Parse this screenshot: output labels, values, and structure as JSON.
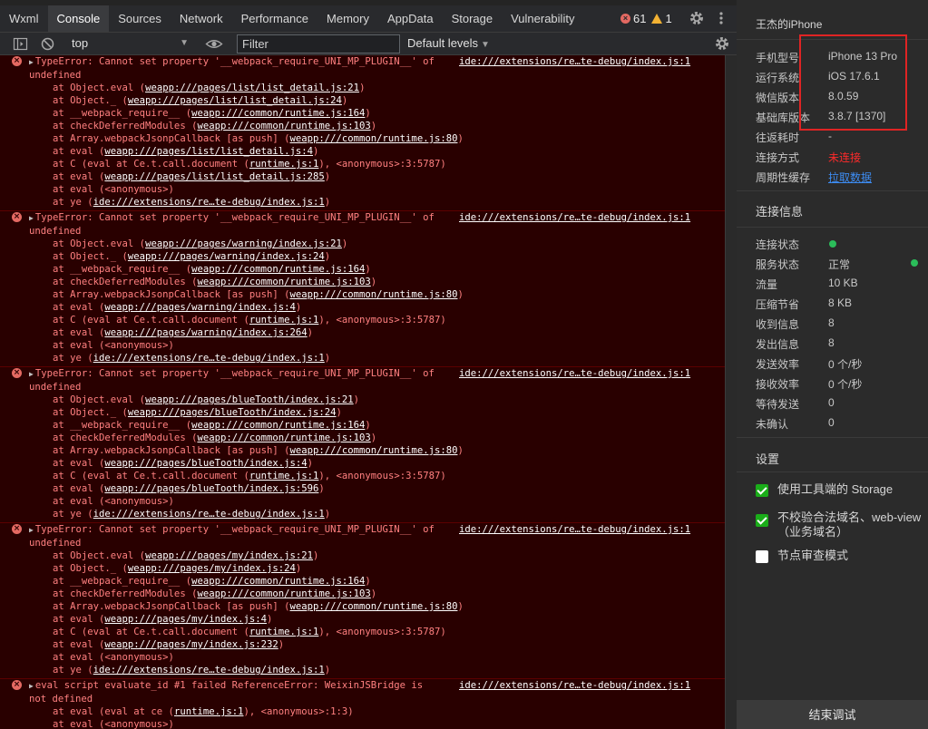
{
  "tabs": [
    "Wxml",
    "Console",
    "Sources",
    "Network",
    "Performance",
    "Memory",
    "AppData",
    "Storage",
    "Vulnerability"
  ],
  "active_tab": "Console",
  "counters": {
    "errors": "61",
    "warnings": "1"
  },
  "filterbar": {
    "context": "top",
    "filter_placeholder": "Filter",
    "levels": "Default levels"
  },
  "console": {
    "entries": [
      {
        "message": "TypeError: Cannot set property '__webpack_require_UNI_MP_PLUGIN__' of",
        "source": "ide:///extensions/re…te-debug/index.js:1",
        "continuation": "undefined",
        "frames": [
          {
            "pre": "at Object.eval (",
            "link": "weapp:///pages/list/list_detail.js:21",
            "post": ")"
          },
          {
            "pre": "at Object._ (",
            "link": "weapp:///pages/list/list_detail.js:24",
            "post": ")"
          },
          {
            "pre": "at __webpack_require__ (",
            "link": "weapp:///common/runtime.js:164",
            "post": ")"
          },
          {
            "pre": "at checkDeferredModules (",
            "link": "weapp:///common/runtime.js:103",
            "post": ")"
          },
          {
            "pre": "at Array.webpackJsonpCallback [as push] (",
            "link": "weapp:///common/runtime.js:80",
            "post": ")"
          },
          {
            "pre": "at eval (",
            "link": "weapp:///pages/list/list_detail.js:4",
            "post": ")"
          },
          {
            "pre": "at C (eval at Ce.t.call.document (",
            "link": "runtime.js:1",
            "post": "), <anonymous>:3:5787)"
          },
          {
            "pre": "at eval (",
            "link": "weapp:///pages/list/list_detail.js:285",
            "post": ")"
          },
          {
            "pre": "at eval (<anonymous>)",
            "link": "",
            "post": ""
          },
          {
            "pre": "at ye (",
            "link": "ide:///extensions/re…te-debug/index.js:1",
            "post": ")"
          }
        ]
      },
      {
        "message": "TypeError: Cannot set property '__webpack_require_UNI_MP_PLUGIN__' of",
        "source": "ide:///extensions/re…te-debug/index.js:1",
        "continuation": "undefined",
        "frames": [
          {
            "pre": "at Object.eval (",
            "link": "weapp:///pages/warning/index.js:21",
            "post": ")"
          },
          {
            "pre": "at Object._ (",
            "link": "weapp:///pages/warning/index.js:24",
            "post": ")"
          },
          {
            "pre": "at __webpack_require__ (",
            "link": "weapp:///common/runtime.js:164",
            "post": ")"
          },
          {
            "pre": "at checkDeferredModules (",
            "link": "weapp:///common/runtime.js:103",
            "post": ")"
          },
          {
            "pre": "at Array.webpackJsonpCallback [as push] (",
            "link": "weapp:///common/runtime.js:80",
            "post": ")"
          },
          {
            "pre": "at eval (",
            "link": "weapp:///pages/warning/index.js:4",
            "post": ")"
          },
          {
            "pre": "at C (eval at Ce.t.call.document (",
            "link": "runtime.js:1",
            "post": "), <anonymous>:3:5787)"
          },
          {
            "pre": "at eval (",
            "link": "weapp:///pages/warning/index.js:264",
            "post": ")"
          },
          {
            "pre": "at eval (<anonymous>)",
            "link": "",
            "post": ""
          },
          {
            "pre": "at ye (",
            "link": "ide:///extensions/re…te-debug/index.js:1",
            "post": ")"
          }
        ]
      },
      {
        "message": "TypeError: Cannot set property '__webpack_require_UNI_MP_PLUGIN__' of",
        "source": "ide:///extensions/re…te-debug/index.js:1",
        "continuation": "undefined",
        "frames": [
          {
            "pre": "at Object.eval (",
            "link": "weapp:///pages/blueTooth/index.js:21",
            "post": ")"
          },
          {
            "pre": "at Object._ (",
            "link": "weapp:///pages/blueTooth/index.js:24",
            "post": ")"
          },
          {
            "pre": "at __webpack_require__ (",
            "link": "weapp:///common/runtime.js:164",
            "post": ")"
          },
          {
            "pre": "at checkDeferredModules (",
            "link": "weapp:///common/runtime.js:103",
            "post": ")"
          },
          {
            "pre": "at Array.webpackJsonpCallback [as push] (",
            "link": "weapp:///common/runtime.js:80",
            "post": ")"
          },
          {
            "pre": "at eval (",
            "link": "weapp:///pages/blueTooth/index.js:4",
            "post": ")"
          },
          {
            "pre": "at C (eval at Ce.t.call.document (",
            "link": "runtime.js:1",
            "post": "), <anonymous>:3:5787)"
          },
          {
            "pre": "at eval (",
            "link": "weapp:///pages/blueTooth/index.js:596",
            "post": ")"
          },
          {
            "pre": "at eval (<anonymous>)",
            "link": "",
            "post": ""
          },
          {
            "pre": "at ye (",
            "link": "ide:///extensions/re…te-debug/index.js:1",
            "post": ")"
          }
        ]
      },
      {
        "message": "TypeError: Cannot set property '__webpack_require_UNI_MP_PLUGIN__' of",
        "source": "ide:///extensions/re…te-debug/index.js:1",
        "continuation": "undefined",
        "frames": [
          {
            "pre": "at Object.eval (",
            "link": "weapp:///pages/my/index.js:21",
            "post": ")"
          },
          {
            "pre": "at Object._ (",
            "link": "weapp:///pages/my/index.js:24",
            "post": ")"
          },
          {
            "pre": "at __webpack_require__ (",
            "link": "weapp:///common/runtime.js:164",
            "post": ")"
          },
          {
            "pre": "at checkDeferredModules (",
            "link": "weapp:///common/runtime.js:103",
            "post": ")"
          },
          {
            "pre": "at Array.webpackJsonpCallback [as push] (",
            "link": "weapp:///common/runtime.js:80",
            "post": ")"
          },
          {
            "pre": "at eval (",
            "link": "weapp:///pages/my/index.js:4",
            "post": ")"
          },
          {
            "pre": "at C (eval at Ce.t.call.document (",
            "link": "runtime.js:1",
            "post": "), <anonymous>:3:5787)"
          },
          {
            "pre": "at eval (",
            "link": "weapp:///pages/my/index.js:232",
            "post": ")"
          },
          {
            "pre": "at eval (<anonymous>)",
            "link": "",
            "post": ""
          },
          {
            "pre": "at ye (",
            "link": "ide:///extensions/re…te-debug/index.js:1",
            "post": ")"
          }
        ]
      },
      {
        "message": "eval script evaluate_id #1 failed ReferenceError: WeixinJSBridge is",
        "source": "ide:///extensions/re…te-debug/index.js:1",
        "continuation": "not defined",
        "frames": [
          {
            "pre": "at eval (eval at ce (",
            "link": "runtime.js:1",
            "post": "), <anonymous>:1:3)"
          },
          {
            "pre": "at eval (<anonymous>)",
            "link": "",
            "post": ""
          }
        ]
      }
    ]
  },
  "device": {
    "name": "王杰的iPhone",
    "info": [
      {
        "k": "手机型号",
        "v": "iPhone 13 Pro",
        "style": ""
      },
      {
        "k": "运行系统",
        "v": "iOS 17.6.1",
        "style": ""
      },
      {
        "k": "微信版本",
        "v": "8.0.59",
        "style": ""
      },
      {
        "k": "基础库版本",
        "v": "3.8.7 [1370]",
        "style": ""
      },
      {
        "k": "往返耗时",
        "v": "-",
        "style": ""
      },
      {
        "k": "连接方式",
        "v": "未连接",
        "style": "red"
      },
      {
        "k": "周期性缓存",
        "v": "拉取数据",
        "style": "blue"
      }
    ]
  },
  "connection": {
    "title": "连接信息",
    "rows": [
      {
        "k": "连接状态",
        "v": "",
        "dot": true
      },
      {
        "k": "服务状态",
        "v": "正常",
        "dot": false
      },
      {
        "k": "流量",
        "v": "10 KB",
        "dot": false
      },
      {
        "k": "压缩节省",
        "v": "8 KB",
        "dot": false
      },
      {
        "k": "收到信息",
        "v": "8",
        "dot": false
      },
      {
        "k": "发出信息",
        "v": "8",
        "dot": false
      },
      {
        "k": "发送效率",
        "v": "0 个/秒",
        "dot": false
      },
      {
        "k": "接收效率",
        "v": "0 个/秒",
        "dot": false
      },
      {
        "k": "等待发送",
        "v": "0",
        "dot": false
      },
      {
        "k": "未确认",
        "v": "0",
        "dot": false
      }
    ]
  },
  "settings": {
    "title": "设置",
    "options": [
      {
        "label": "使用工具端的 Storage",
        "checked": true
      },
      {
        "label": "不校验合法域名、web-view（业务域名）",
        "checked": true
      },
      {
        "label": "节点审查模式",
        "checked": false
      }
    ]
  },
  "end_button": "结束调试",
  "colors": {
    "error_bg": "#290000",
    "error_text": "#ff8080",
    "accent_green": "#1aad19",
    "highlight_red": "#e02424"
  }
}
